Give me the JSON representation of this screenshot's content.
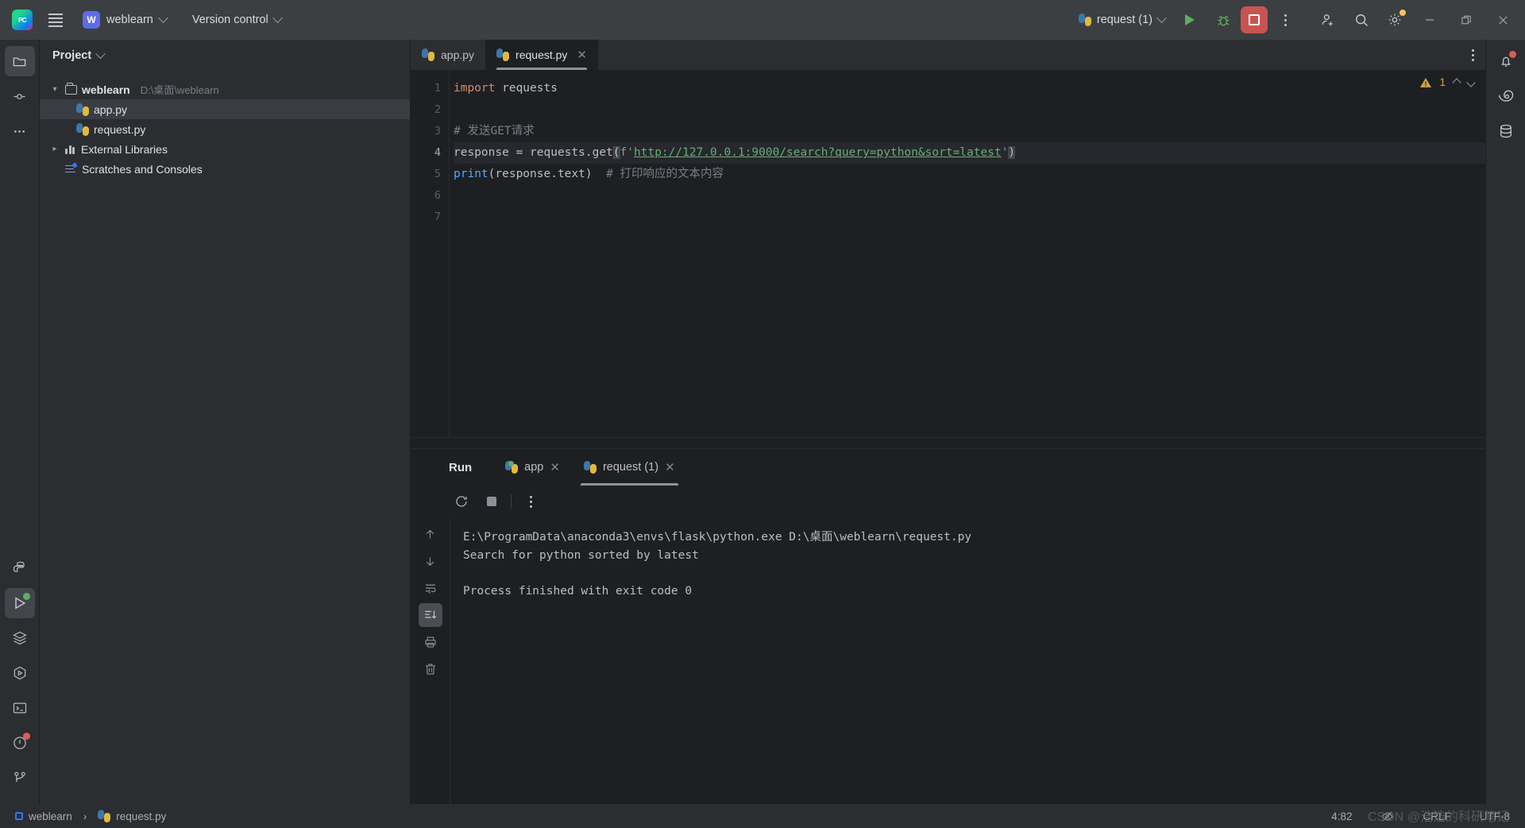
{
  "titlebar": {
    "menu_icon": "hamburger-menu-icon",
    "logo": "pycharm-logo-icon",
    "logo_text": "PC",
    "project_badge": "W",
    "project_name": "weblearn",
    "version_control": "Version control",
    "run_config": "request (1)",
    "run_label": "Run",
    "debug_label": "Debug",
    "stop_label": "Stop",
    "more_label": "More",
    "icons": {
      "add_user": "add-user-icon",
      "search": "search-icon",
      "settings": "settings-gear-icon",
      "minimize": "minimize-icon",
      "maximize": "maximize-icon",
      "close": "close-icon"
    }
  },
  "left_rail": {
    "items": [
      {
        "name": "project",
        "icon": "folder-icon",
        "active": true
      },
      {
        "name": "commit",
        "icon": "commit-icon",
        "active": false
      },
      {
        "name": "more-tool-windows",
        "icon": "more-dots-icon",
        "active": false
      }
    ],
    "bottom_items": [
      {
        "name": "python-packages",
        "icon": "python-icon",
        "active": false
      },
      {
        "name": "run",
        "icon": "run-icon",
        "active": true,
        "badge": "green-dot"
      },
      {
        "name": "services",
        "icon": "layers-icon",
        "active": false
      },
      {
        "name": "python-console",
        "icon": "python-console-icon",
        "active": false
      },
      {
        "name": "terminal",
        "icon": "terminal-icon",
        "active": false
      },
      {
        "name": "problems",
        "icon": "problems-icon",
        "active": false,
        "badge": "red-dot"
      },
      {
        "name": "version-control",
        "icon": "git-branch-icon",
        "active": false
      }
    ]
  },
  "project_panel": {
    "title": "Project",
    "tree": [
      {
        "label": "weblearn",
        "path": "D:\\桌面\\weblearn",
        "icon": "folder-icon",
        "indent": 0,
        "expanded": true,
        "selected": false,
        "bold": true
      },
      {
        "label": "app.py",
        "path": "",
        "icon": "python-file-icon",
        "indent": 1,
        "expanded": null,
        "selected": true,
        "bold": false
      },
      {
        "label": "request.py",
        "path": "",
        "icon": "python-file-icon",
        "indent": 1,
        "expanded": null,
        "selected": false,
        "bold": false
      },
      {
        "label": "External Libraries",
        "path": "",
        "icon": "library-icon",
        "indent": 0,
        "expanded": false,
        "selected": false,
        "bold": false
      },
      {
        "label": "Scratches and Consoles",
        "path": "",
        "icon": "scratches-icon",
        "indent": 0,
        "expanded": null,
        "selected": false,
        "bold": false
      }
    ]
  },
  "editor": {
    "tabs": [
      {
        "label": "app.py",
        "icon": "python-file-icon",
        "active": false,
        "closable": false
      },
      {
        "label": "request.py",
        "icon": "python-file-icon",
        "active": true,
        "closable": true
      }
    ],
    "inspection": {
      "warning_count": "1",
      "icon": "warning-triangle-icon"
    },
    "lines": [
      {
        "no": "1",
        "current": false,
        "tokens": [
          {
            "t": "import",
            "c": "kw"
          },
          {
            "t": " requests",
            "c": "def"
          }
        ]
      },
      {
        "no": "2",
        "current": false,
        "tokens": []
      },
      {
        "no": "3",
        "current": false,
        "tokens": [
          {
            "t": "# 发送GET请求",
            "c": "cm"
          }
        ]
      },
      {
        "no": "4",
        "current": true,
        "tokens": [
          {
            "t": "response = requests.get",
            "c": "def"
          },
          {
            "t": "(",
            "c": "caretbox"
          },
          {
            "t": "f",
            "c": "str"
          },
          {
            "t": "'",
            "c": "str"
          },
          {
            "t": "http://127.0.0.1:9000/search?query=python&sort=latest",
            "c": "url"
          },
          {
            "t": "'",
            "c": "str"
          },
          {
            "t": ")",
            "c": "caretbox"
          }
        ]
      },
      {
        "no": "5",
        "current": false,
        "tokens": [
          {
            "t": "print",
            "c": "fn"
          },
          {
            "t": "(response.text)",
            "c": "def"
          },
          {
            "t": "  # 打印响应的文本内容",
            "c": "cm"
          }
        ]
      },
      {
        "no": "6",
        "current": false,
        "tokens": []
      },
      {
        "no": "7",
        "current": false,
        "tokens": []
      }
    ]
  },
  "run_panel": {
    "title": "Run",
    "tabs": [
      {
        "label": "app",
        "icon": "python-icon",
        "active": false,
        "running": true
      },
      {
        "label": "request (1)",
        "icon": "python-icon",
        "active": true,
        "running": false
      }
    ],
    "toolbar": [
      {
        "name": "rerun-button",
        "icon": "rerun-icon"
      },
      {
        "name": "stop-button",
        "icon": "stop-icon"
      },
      {
        "name": "more-options-button",
        "icon": "kebab-icon"
      }
    ],
    "side_toolbar": [
      {
        "name": "previous-occurrence",
        "icon": "arrow-up-icon",
        "active": false
      },
      {
        "name": "next-occurrence",
        "icon": "arrow-down-icon",
        "active": false
      },
      {
        "name": "soft-wrap",
        "icon": "soft-wrap-icon",
        "active": false
      },
      {
        "name": "scroll-to-end",
        "icon": "scroll-to-end-icon",
        "active": true
      },
      {
        "name": "print",
        "icon": "printer-icon",
        "active": false
      },
      {
        "name": "clear-all",
        "icon": "trash-icon",
        "active": false
      }
    ],
    "console_output": "E:\\ProgramData\\anaconda3\\envs\\flask\\python.exe D:\\桌面\\weblearn\\request.py\nSearch for python sorted by latest\n\nProcess finished with exit code 0"
  },
  "right_rail": {
    "items": [
      {
        "name": "notifications",
        "icon": "bell-icon",
        "badge": "red-dot"
      },
      {
        "name": "ai-assistant",
        "icon": "ai-spiral-icon",
        "badge": ""
      },
      {
        "name": "database",
        "icon": "database-icon",
        "badge": ""
      }
    ]
  },
  "status_bar": {
    "project": "weblearn",
    "separator": "›",
    "file": "request.py",
    "caret_position": "4:82",
    "indent_icon": "crossed-eye-icon",
    "line_separator": "CRLF",
    "encoding": "UTF-8",
    "watermark": "CSDN @浩浩的科研笔记"
  },
  "colors": {
    "accent": "#3574f0",
    "run_green": "#5fad65",
    "stop_red": "#c75450",
    "warning": "#c9a34a",
    "string_green": "#6aab73",
    "keyword_orange": "#cf8e6d",
    "function_blue": "#56a8f5"
  }
}
